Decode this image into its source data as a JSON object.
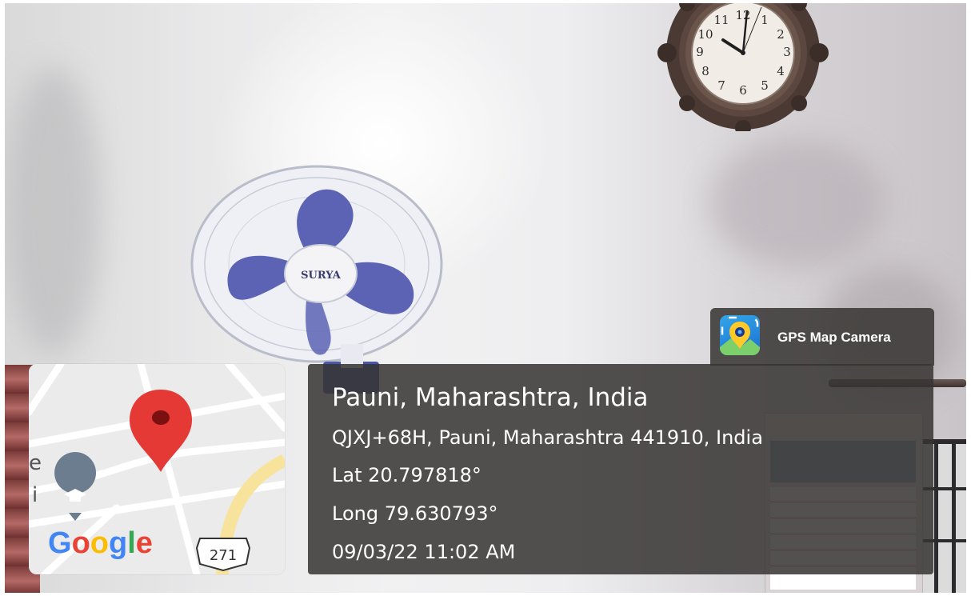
{
  "app": {
    "name": "GPS Map Camera",
    "icon": "gps-map-camera-app-icon"
  },
  "location": {
    "title": "Pauni, Maharashtra, India",
    "address": "QJXJ+68H, Pauni, Maharashtra 441910, India",
    "latitude": "Lat 20.797818°",
    "longitude": "Long 79.630793°",
    "datetime": "09/03/22 11:02 AM"
  },
  "map": {
    "brand": "Google",
    "route_shield": "271",
    "map_text_fragments": [
      "e",
      "i"
    ],
    "icons": [
      "location-pin-icon",
      "school-icon",
      "route-shield-icon"
    ]
  },
  "photo": {
    "fan_brand": "SURYA",
    "clock_numerals": [
      "12",
      "1",
      "2",
      "3",
      "4",
      "5",
      "6",
      "7",
      "8",
      "9",
      "10",
      "11"
    ]
  },
  "colors": {
    "panel": "#373432",
    "pin": "#e53935",
    "google_blue": "#4285f4",
    "google_red": "#ea4335",
    "google_yellow": "#fbbc05",
    "google_green": "#34a853"
  }
}
